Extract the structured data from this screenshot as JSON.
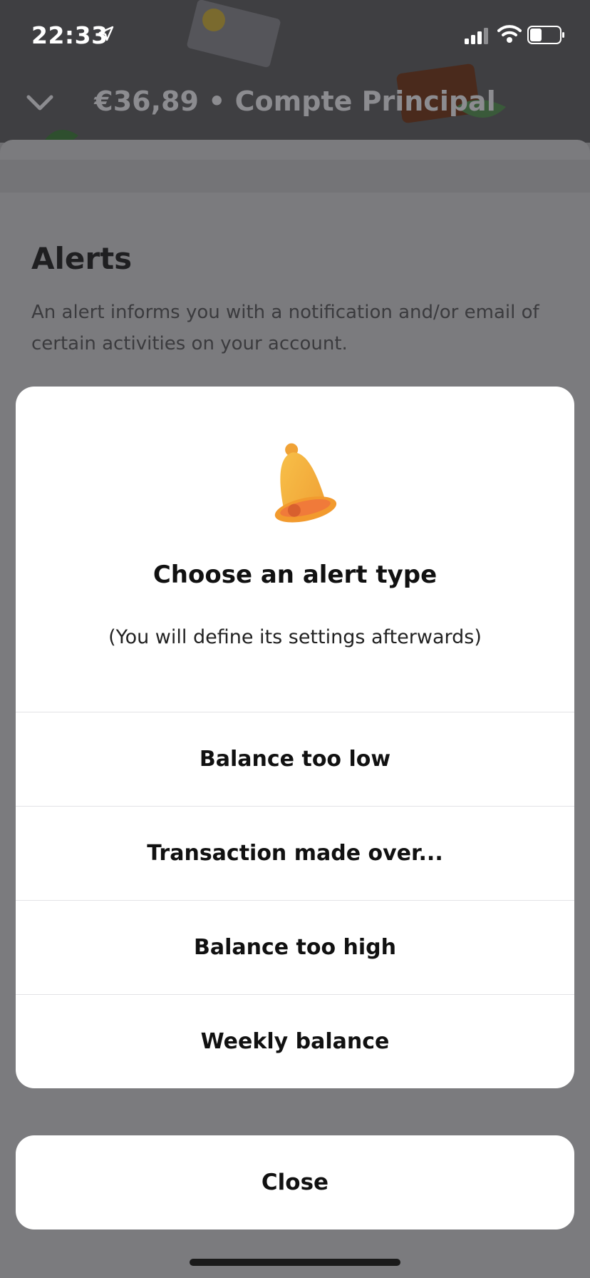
{
  "status_bar": {
    "time": "22:33",
    "icons": [
      "location-arrow-icon",
      "signal-icon",
      "wifi-icon",
      "battery-icon"
    ]
  },
  "header": {
    "title": "€36,89 • Compte Principal",
    "back_icon": "chevron-down-icon"
  },
  "page": {
    "title": "Alerts",
    "description": "An alert informs you with a notification and/or email of certain activities on your account."
  },
  "action_sheet": {
    "icon": "bell-icon",
    "title": "Choose an alert type",
    "subtitle": "(You will define its settings afterwards)",
    "options": [
      "Balance too low",
      "Transaction made over...",
      "Balance too high",
      "Weekly balance"
    ],
    "close_label": "Close"
  },
  "colors": {
    "overlay": "#6f6f72",
    "sheet": "#ffffff",
    "bell": "#f5b23a",
    "text": "#111111"
  }
}
